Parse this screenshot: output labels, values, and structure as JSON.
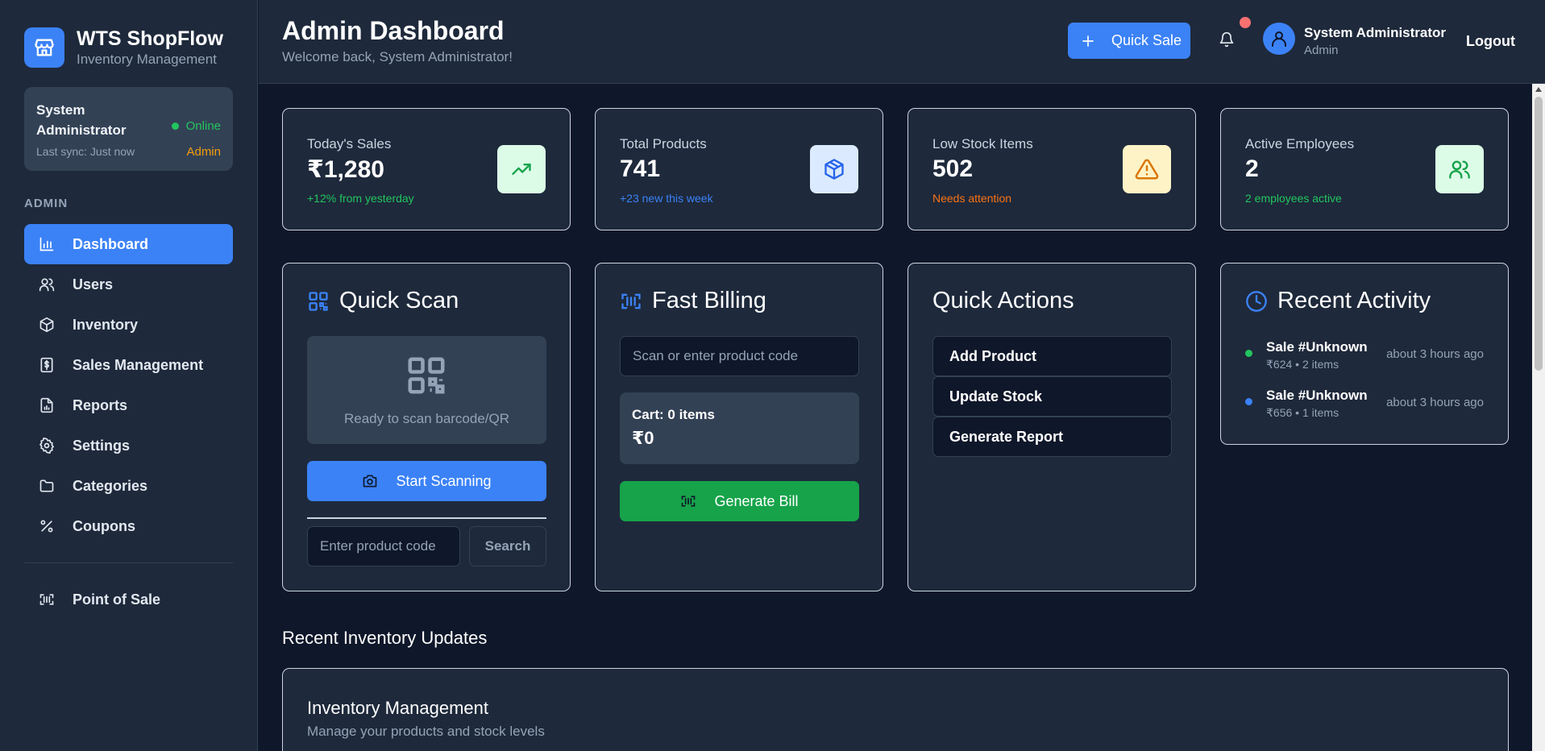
{
  "brand": {
    "title": "WTS ShopFlow",
    "subtitle": "Inventory Management"
  },
  "status": {
    "name": "System Administrator",
    "online": "Online",
    "sync": "Last sync: Just now",
    "role": "Admin"
  },
  "sidebar": {
    "section": "ADMIN",
    "items": [
      {
        "label": "Dashboard",
        "icon": "bar-chart-icon"
      },
      {
        "label": "Users",
        "icon": "users-icon"
      },
      {
        "label": "Inventory",
        "icon": "box-icon"
      },
      {
        "label": "Sales Management",
        "icon": "dollar-receipt-icon"
      },
      {
        "label": "Reports",
        "icon": "report-icon"
      },
      {
        "label": "Settings",
        "icon": "gear-icon"
      },
      {
        "label": "Categories",
        "icon": "folder-icon"
      },
      {
        "label": "Coupons",
        "icon": "percent-icon"
      }
    ],
    "pos": {
      "label": "Point of Sale",
      "icon": "barcode-icon"
    }
  },
  "header": {
    "title": "Admin Dashboard",
    "subtitle": "Welcome back, System Administrator!",
    "quick_sale": "Quick Sale",
    "user_name": "System Administrator",
    "user_role": "Admin",
    "logout": "Logout"
  },
  "stats": [
    {
      "label": "Today's Sales",
      "value": "₹1,280",
      "note": "+12% from yesterday",
      "color": "#22c55e",
      "icon": "trending-up-icon"
    },
    {
      "label": "Total Products",
      "value": "741",
      "note": "+23 new this week",
      "color": "#3b82f6",
      "icon": "box-icon"
    },
    {
      "label": "Low Stock Items",
      "value": "502",
      "note": "Needs attention",
      "color": "#f97316",
      "icon": "warning-icon"
    },
    {
      "label": "Active Employees",
      "value": "2",
      "note": "2 employees active",
      "color": "#22c55e",
      "icon": "users-icon"
    }
  ],
  "quick_scan": {
    "title": "Quick Scan",
    "ready": "Ready to scan barcode/QR",
    "start": "Start Scanning",
    "code_placeholder": "Enter product code",
    "search": "Search"
  },
  "billing": {
    "title": "Fast Billing",
    "placeholder": "Scan or enter product code",
    "cart": "Cart: 0 items",
    "total": "₹0",
    "generate": "Generate Bill"
  },
  "quick_actions": {
    "title": "Quick Actions",
    "items": [
      "Add Product",
      "Update Stock",
      "Generate Report"
    ]
  },
  "recent_activity": {
    "title": "Recent Activity",
    "items": [
      {
        "title": "Sale #Unknown",
        "detail": "₹624 • 2 items",
        "time": "about 3 hours ago",
        "color": "#22c55e"
      },
      {
        "title": "Sale #Unknown",
        "detail": "₹656 • 1 items",
        "time": "about 3 hours ago",
        "color": "#3b82f6"
      }
    ]
  },
  "inventory_updates": {
    "heading": "Recent Inventory Updates",
    "card_title": "Inventory Management",
    "card_sub": "Manage your products and stock levels"
  }
}
